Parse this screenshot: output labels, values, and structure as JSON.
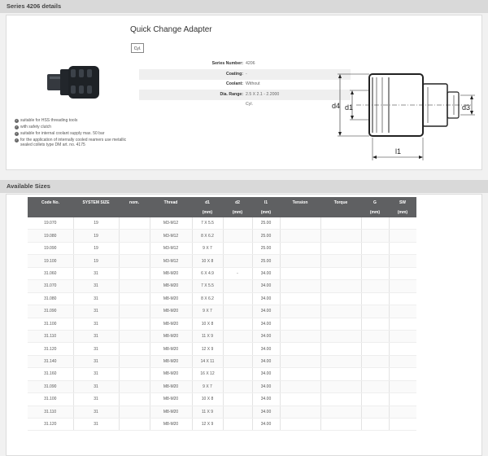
{
  "series_section": {
    "title": "Series 4206 details"
  },
  "product": {
    "title": "Quick Change Adapter",
    "badge": "Cyl.",
    "details": [
      {
        "label": "Series Number:",
        "value": "4206"
      },
      {
        "label": "Coating:",
        "value": "-"
      },
      {
        "label": "Coolant:",
        "value": "Without"
      },
      {
        "label": "Dia. Range:",
        "value": "2.5 X 2.1 - 2.2000"
      },
      {
        "label": "",
        "value": "Cyl."
      }
    ],
    "features": [
      "suitable for HSS threading tools",
      "with safety clutch",
      "suitable for internal coolant supply max. 50 bar",
      "for the application of internally cooled reamers use metallic sealed collets type DM art. no. 4175"
    ]
  },
  "diagram": {
    "labels": {
      "d4": "d4",
      "d1": "d1",
      "d3": "d3",
      "l1": "l1"
    }
  },
  "sizes_section": {
    "title": "Available Sizes"
  },
  "table": {
    "headers": [
      "Code No.",
      "SYSTEM SIZE",
      "nom.",
      "Thread",
      "d1",
      "d2",
      "l1",
      "Tension",
      "Torque",
      "G",
      "SW"
    ],
    "units": [
      "",
      "",
      "",
      "",
      "(mm)",
      "(mm)",
      "(mm)",
      "",
      "",
      "(mm)",
      "(mm)"
    ],
    "rows": [
      [
        "19.070",
        "19",
        "",
        "M3-M12",
        "7 X 5.5",
        "",
        "25.00"
      ],
      [
        "19.080",
        "19",
        "",
        "M3-M12",
        "8 X 6.2",
        "",
        "25.00"
      ],
      [
        "19.090",
        "19",
        "",
        "M3-M12",
        "9 X 7",
        "",
        "25.00"
      ],
      [
        "19.100",
        "19",
        "",
        "M3-M12",
        "10 X 8",
        "",
        "25.00"
      ],
      [
        "31.060",
        "31",
        "",
        "M8-M20",
        "6 X 4.9",
        "-",
        "34.00"
      ],
      [
        "31.070",
        "31",
        "",
        "M8-M20",
        "7 X 5.5",
        "",
        "34.00"
      ],
      [
        "31.080",
        "31",
        "",
        "M8-M20",
        "8 X 6.2",
        "",
        "34.00"
      ],
      [
        "31.090",
        "31",
        "",
        "M8-M20",
        "9 X 7",
        "",
        "34.00"
      ],
      [
        "31.100",
        "31",
        "",
        "M8-M20",
        "10 X 8",
        "",
        "34.00"
      ],
      [
        "31.110",
        "31",
        "",
        "M8-M20",
        "11 X 9",
        "",
        "34.00"
      ],
      [
        "31.120",
        "31",
        "",
        "M8-M20",
        "12 X 9",
        "",
        "34.00"
      ],
      [
        "31.140",
        "31",
        "",
        "M8-M20",
        "14 X 11",
        "",
        "34.00"
      ],
      [
        "31.160",
        "31",
        "",
        "M8-M20",
        "16 X 12",
        "",
        "34.00"
      ],
      [
        "31.090",
        "31",
        "",
        "M8-M20",
        "9 X 7",
        "",
        "34.00"
      ],
      [
        "31.100",
        "31",
        "",
        "M8-M20",
        "10 X 8",
        "",
        "34.00"
      ],
      [
        "31.110",
        "31",
        "",
        "M8-M20",
        "11 X 9",
        "",
        "34.00"
      ],
      [
        "31.120",
        "31",
        "",
        "M8-M20",
        "12 X 9",
        "",
        "34.00"
      ]
    ]
  }
}
